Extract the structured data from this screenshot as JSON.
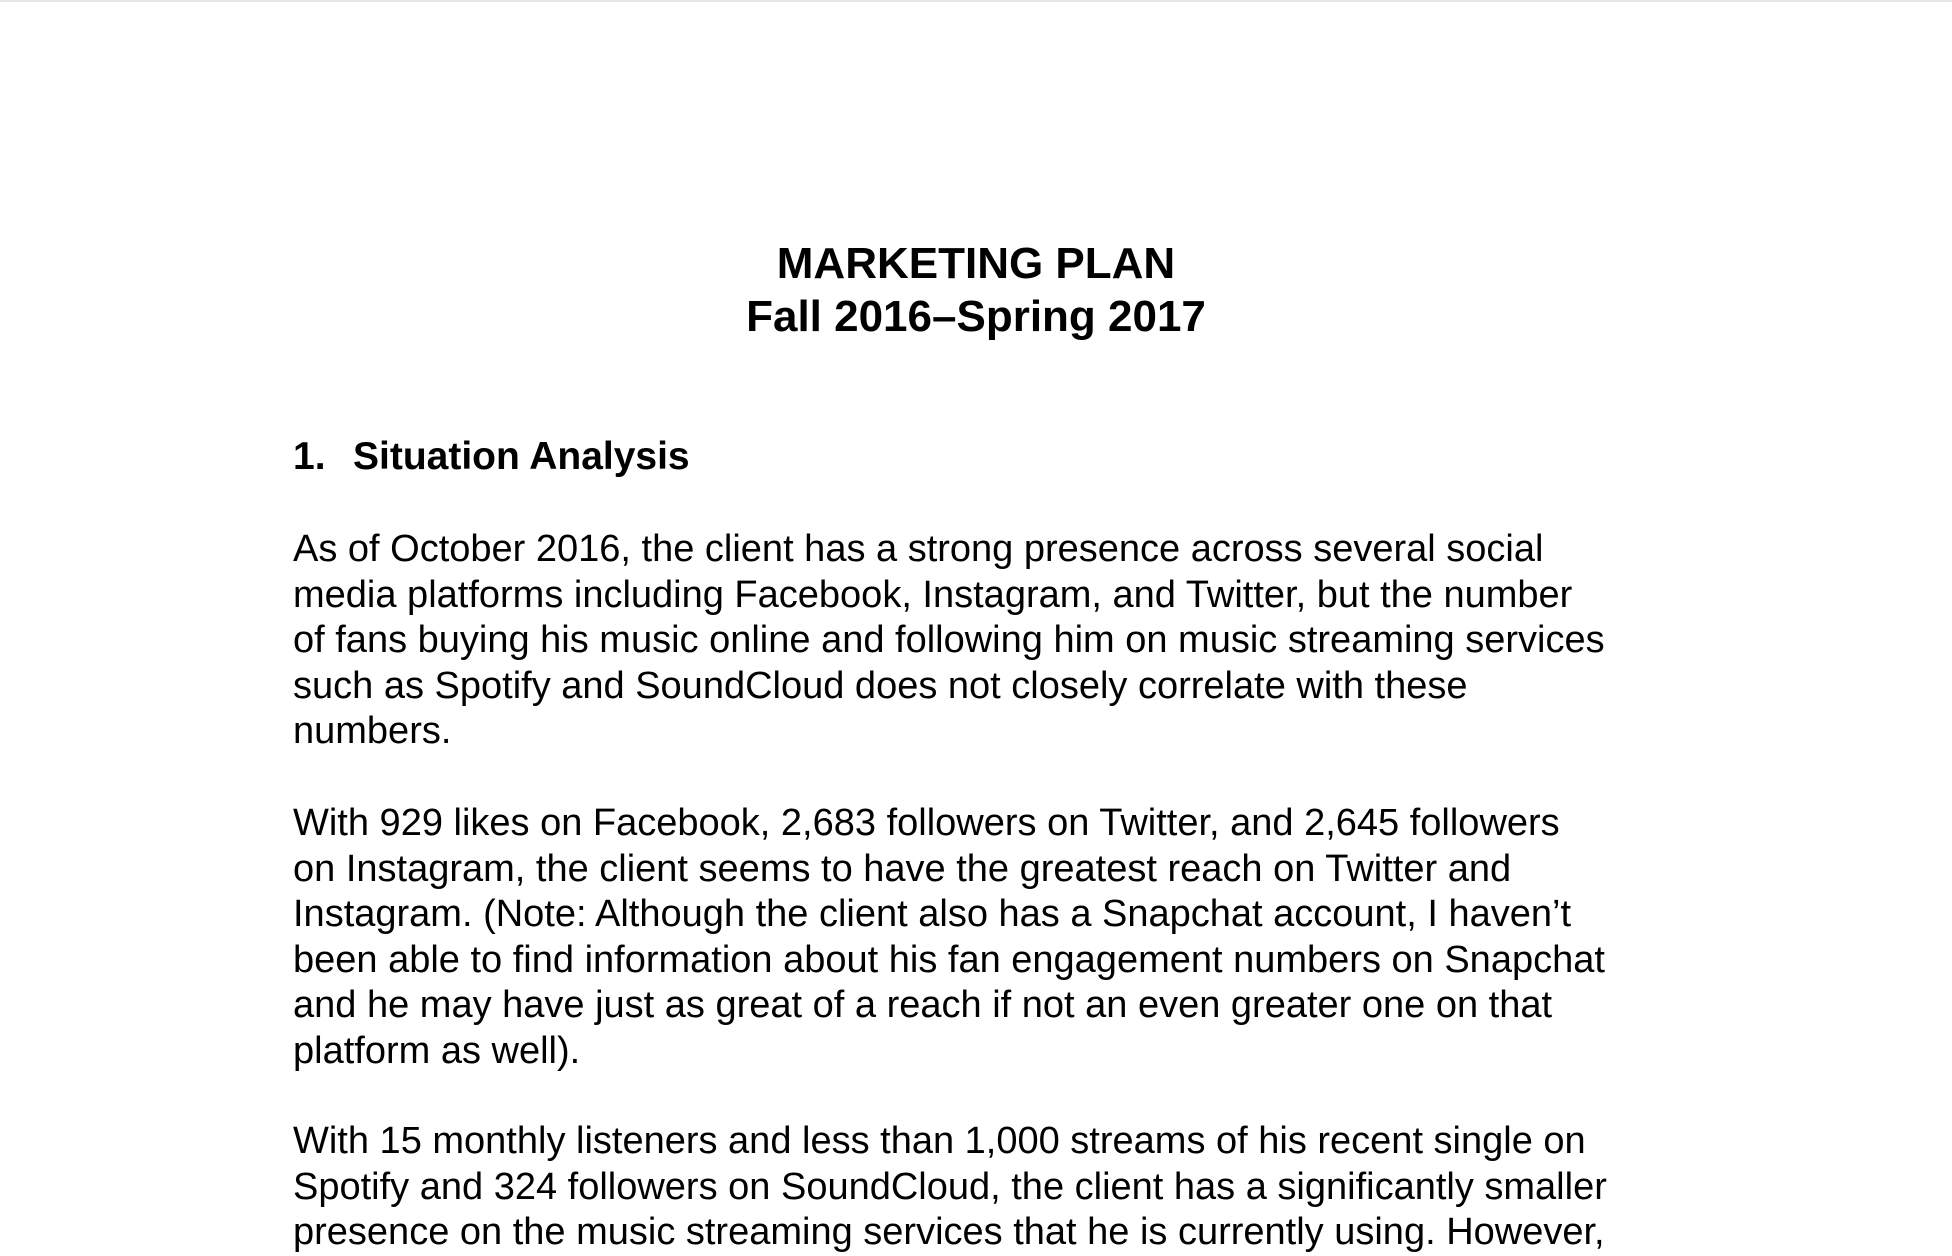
{
  "document": {
    "title_line1": "MARKETING PLAN",
    "title_line2": "Fall 2016–Spring 2017",
    "section1": {
      "number": "1.",
      "heading": "Situation Analysis",
      "paragraphs": [
        {
          "lines": [
            "As of October 2016, the client has a strong presence across several social",
            "media platforms including Facebook, Instagram, and Twitter, but the number",
            "of fans buying his music online and following him on music streaming services",
            "such as Spotify and SoundCloud does not closely correlate with these",
            "numbers."
          ]
        },
        {
          "lines": [
            "With 929 likes on Facebook, 2,683 followers on Twitter, and 2,645 followers",
            "on Instagram, the client seems to have the greatest reach on Twitter and",
            "Instagram. (Note: Although the client also has a Snapchat account, I haven’t",
            "been able to find information about his fan engagement numbers on Snapchat",
            "and he may have just as great of a reach if not an even greater one on that",
            "platform as well)."
          ]
        },
        {
          "lines": [
            "With 15 monthly listeners and less than 1,000 streams of his recent single on",
            "Spotify and 324 followers on SoundCloud, the client has a significantly smaller",
            "presence on the music streaming services that he is currently using. However,"
          ]
        }
      ]
    }
  }
}
